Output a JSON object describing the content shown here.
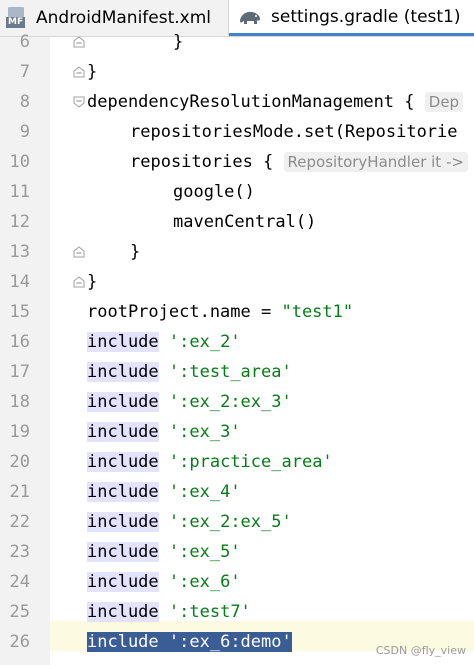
{
  "tabs": [
    {
      "label": "AndroidManifest.xml",
      "icon": "manifest-file-icon",
      "active": false
    },
    {
      "label": "settings.gradle (test1)",
      "icon": "gradle-elephant-icon",
      "active": true
    }
  ],
  "lines": [
    {
      "num": "6",
      "indent": 2,
      "text": "}"
    },
    {
      "num": "7",
      "indent": 0,
      "text": "}"
    },
    {
      "num": "8",
      "indent": 0,
      "text": "dependencyResolutionManagement { ",
      "hint": "Dep"
    },
    {
      "num": "9",
      "indent": 1,
      "text": "repositoriesMode.set(Repositorie"
    },
    {
      "num": "10",
      "indent": 1,
      "text": "repositories { ",
      "hint": "RepositoryHandler it ->"
    },
    {
      "num": "11",
      "indent": 2,
      "text": "google()"
    },
    {
      "num": "12",
      "indent": 2,
      "text": "mavenCentral()"
    },
    {
      "num": "13",
      "indent": 1,
      "text": "}"
    },
    {
      "num": "14",
      "indent": 0,
      "text": "}"
    },
    {
      "num": "15",
      "indent": 0,
      "pre": "rootProject.name = ",
      "str": "\"test1\""
    },
    {
      "num": "16",
      "kw": "include",
      "str": "':ex_2'"
    },
    {
      "num": "17",
      "kw": "include",
      "str": "':test_area'"
    },
    {
      "num": "18",
      "kw": "include",
      "str": "':ex_2:ex_3'"
    },
    {
      "num": "19",
      "kw": "include",
      "str": "':ex_3'"
    },
    {
      "num": "20",
      "kw": "include",
      "str": "':practice_area'"
    },
    {
      "num": "21",
      "kw": "include",
      "str": "':ex_4'"
    },
    {
      "num": "22",
      "kw": "include",
      "str": "':ex_2:ex_5'"
    },
    {
      "num": "23",
      "kw": "include",
      "str": "':ex_5'"
    },
    {
      "num": "24",
      "kw": "include",
      "str": "':ex_6'"
    },
    {
      "num": "25",
      "kw": "include",
      "str": "':test7'"
    },
    {
      "num": "26",
      "kw": "include",
      "str": "':ex_6:demo'",
      "selected": true
    }
  ],
  "watermark": "CSDN @fly_view",
  "colors": {
    "string": "#067d17",
    "selection": "#3b5d95",
    "include_highlight": "#e3e3ff",
    "tab_underline": "#4083c9"
  }
}
